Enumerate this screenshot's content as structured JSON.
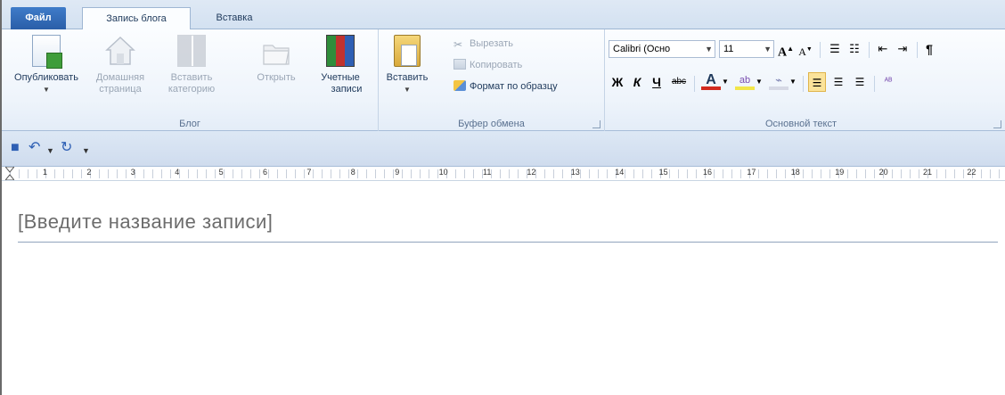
{
  "tabs": {
    "file": "Файл",
    "blog_post": "Запись блога",
    "insert": "Вставка"
  },
  "ribbon": {
    "blog_group": {
      "label": "Блог",
      "publish": "Опубликовать",
      "home_line1": "Домашняя",
      "home_line2": "страница",
      "insert_cat_line1": "Вставить",
      "insert_cat_line2": "категорию",
      "open": "Открыть",
      "accounts_line1": "Учетные",
      "accounts_line2": "записи"
    },
    "clipboard_group": {
      "label": "Буфер обмена",
      "paste": "Вставить",
      "cut": "Вырезать",
      "copy": "Копировать",
      "format_painter": "Формат по образцу"
    },
    "font_group": {
      "label": "Основной текст",
      "font_name": "Calibri (Осно",
      "font_size": "11",
      "bold": "Ж",
      "italic": "К",
      "underline": "Ч",
      "strike": "abc"
    }
  },
  "document": {
    "title_placeholder": "[Введите название записи]"
  },
  "ruler": {
    "numbers": [
      "1",
      "2",
      "3",
      "4",
      "5",
      "6",
      "7",
      "8",
      "9",
      "10",
      "11",
      "12",
      "13",
      "14",
      "15",
      "16",
      "17",
      "18",
      "19",
      "20",
      "21",
      "22"
    ]
  },
  "colors": {
    "file_tab": "#2a5ea8",
    "ribbon_bg": "#eef4fb",
    "group_label": "#5a7190",
    "font_color_red": "#d22a1e",
    "highlight_yellow": "#f2e64a"
  },
  "icons": {
    "save": "save-icon",
    "undo": "undo-icon",
    "redo": "redo-icon",
    "qat_more": "chevron-down-icon"
  }
}
